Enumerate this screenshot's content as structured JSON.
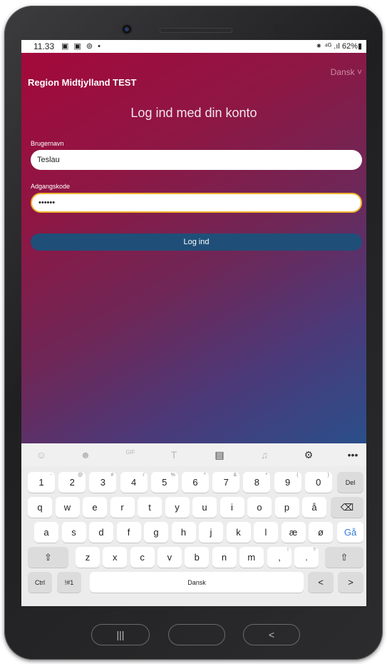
{
  "status": {
    "time": "11.33",
    "icons_left": "▣ ▣ ⊚ •",
    "icons_right": "⁕ ⁴ᴳ .ıl 62%▮"
  },
  "app": {
    "language": "Dansk ˅",
    "brand": "Region Midtjylland TEST",
    "heading": "Log ind med din konto",
    "username_label": "Brugernavn",
    "username_value": "Teslau",
    "password_label": "Adgangskode",
    "password_value": "••••••",
    "login_button": "Log ind"
  },
  "keyboard": {
    "toolbar": [
      {
        "name": "emoji-icon",
        "glyph": "☺"
      },
      {
        "name": "sticker-icon",
        "glyph": "☻"
      },
      {
        "name": "gif-icon",
        "glyph": "GIF"
      },
      {
        "name": "handwriting-icon",
        "glyph": "T"
      },
      {
        "name": "clipboard-icon",
        "glyph": "▤"
      },
      {
        "name": "mic-icon",
        "glyph": "♫"
      },
      {
        "name": "settings-icon",
        "glyph": "⚙"
      },
      {
        "name": "more-icon",
        "glyph": "•••"
      }
    ],
    "row1": [
      {
        "k": "1",
        "h": "-"
      },
      {
        "k": "2",
        "h": "@"
      },
      {
        "k": "3",
        "h": "#"
      },
      {
        "k": "4",
        "h": "/"
      },
      {
        "k": "5",
        "h": "%"
      },
      {
        "k": "6",
        "h": "^"
      },
      {
        "k": "7",
        "h": "&"
      },
      {
        "k": "8",
        "h": "*"
      },
      {
        "k": "9",
        "h": "("
      },
      {
        "k": "0",
        "h": ")"
      }
    ],
    "row1_del": "Del",
    "row2": [
      "q",
      "w",
      "e",
      "r",
      "t",
      "y",
      "u",
      "i",
      "o",
      "p",
      "å"
    ],
    "row3": [
      "a",
      "s",
      "d",
      "f",
      "g",
      "h",
      "j",
      "k",
      "l",
      "æ",
      "ø"
    ],
    "row3_go": "Gå",
    "row4": [
      "z",
      "x",
      "c",
      "v",
      "b",
      "n",
      "m"
    ],
    "row4_comma": ",",
    "row4_comma_hint": "!",
    "row4_period": ".",
    "row4_period_hint": "?",
    "ctrl": "Ctrl",
    "sym": "!#1",
    "space": "Dansk",
    "left": "<",
    "right": ">"
  },
  "nav": {
    "recents": "|||",
    "home": "",
    "back": "<"
  }
}
